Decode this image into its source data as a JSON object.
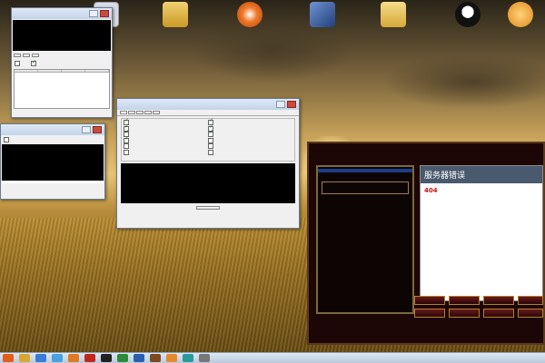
{
  "desktop": {
    "icons": [
      {
        "name": "recycle-bin-icon",
        "label": "",
        "color": "#d8dde6"
      },
      {
        "name": "user-folder-icon",
        "label": "",
        "color": "#d9b23c"
      },
      {
        "name": "app-orange-icon",
        "label": "",
        "color": "#e36a1b"
      },
      {
        "name": "media-folder-icon",
        "label": "",
        "color": "#3a63a8"
      },
      {
        "name": "folder-icon",
        "label": "",
        "color": "#e8c96a"
      },
      {
        "name": "qq-penguin-icon",
        "label": "",
        "color": "#1a1a1a"
      },
      {
        "name": "cat-mascot-icon",
        "label": "",
        "color": "#f2a93a"
      }
    ]
  },
  "account_window": {
    "title": "",
    "buttons": [
      "",
      "",
      ""
    ],
    "console_lines": [
      "",
      "",
      "",
      ""
    ],
    "checkboxes": [
      {
        "label": "",
        "checked": false
      },
      {
        "label": "",
        "checked": true
      }
    ],
    "table_headers": [
      "",
      "",
      "",
      ""
    ],
    "table_row": [
      "",
      "",
      ""
    ]
  },
  "left_window": {
    "title": "",
    "fields": [
      {
        "label": "",
        "value": ""
      },
      {
        "label": "",
        "value": ""
      }
    ],
    "console_lines": [
      "",
      "",
      "",
      "",
      "",
      "",
      ""
    ],
    "footer_values": [
      "",
      ""
    ]
  },
  "db_window": {
    "title": "",
    "tabs": [
      "",
      "",
      "",
      "",
      ""
    ],
    "group_label": "",
    "checkboxes_left": [
      {
        "label": "",
        "checked": true
      },
      {
        "label": "",
        "checked": true
      },
      {
        "label": "",
        "checked": true
      },
      {
        "label": "",
        "checked": true
      },
      {
        "label": "",
        "checked": false
      },
      {
        "label": "",
        "checked": false
      },
      {
        "label": "",
        "checked": false
      }
    ],
    "checkboxes_right": [
      {
        "label": "",
        "checked": true
      },
      {
        "label": "",
        "checked": true
      },
      {
        "label": "",
        "checked": true
      },
      {
        "label": "",
        "checked": false
      },
      {
        "label": "",
        "checked": false
      },
      {
        "label": "",
        "checked": false
      },
      {
        "label": "",
        "checked": false
      }
    ],
    "console_lines": [
      "",
      "",
      "",
      "",
      "",
      "",
      ""
    ],
    "start_button": "",
    "hint_text": ""
  },
  "launcher": {
    "title": "",
    "menu_header": "",
    "menu_items": [
      "",
      "",
      "",
      "",
      ""
    ],
    "side_info_lines": [
      "",
      "",
      "",
      "",
      "",
      ""
    ],
    "error_heading": "服务器错误",
    "error_code": "404",
    "error_message": "",
    "error_detail": "",
    "footer_buttons_row1": [
      "",
      "",
      "",
      ""
    ],
    "footer_buttons_row2": [
      "",
      "",
      "",
      ""
    ],
    "status_line": ""
  },
  "taskbar": {
    "apps": [
      "mi-browser-icon",
      "folder-icon",
      "shield-icon",
      "bird-icon",
      "app-orange-icon",
      "app-red-icon",
      "app-black-icon",
      "app-green-icon",
      "app-blue-icon",
      "app-brown-icon",
      "app-orange-icon",
      "app-teal-icon",
      "app-gray-icon"
    ],
    "clock_time": "",
    "clock_date": ""
  }
}
